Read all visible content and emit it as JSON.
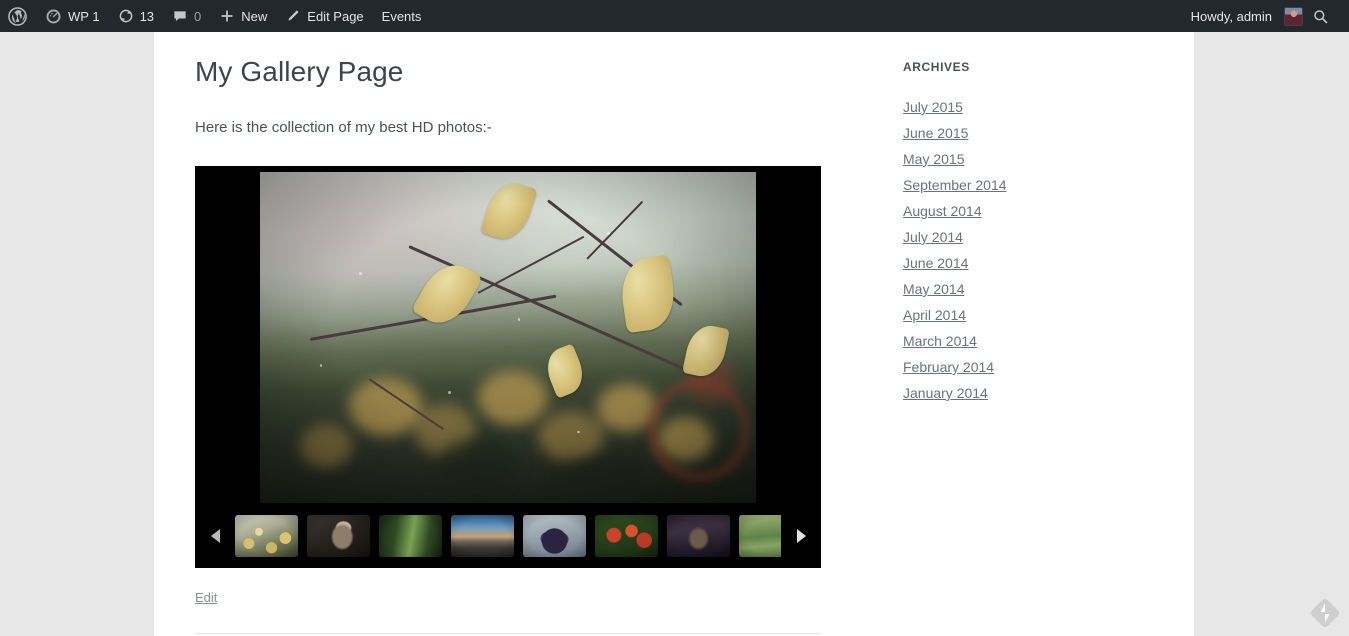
{
  "adminbar": {
    "wp_logo_icon": "wordpress-logo-icon",
    "site_icon": "dashboard-speedometer-icon",
    "site_label": "WP 1",
    "updates_icon": "updates-refresh-icon",
    "updates_count": "13",
    "comments_icon": "comment-bubble-icon",
    "comments_count": "0",
    "new_icon": "plus-icon",
    "new_label": "New",
    "edit_icon": "pencil-icon",
    "edit_label": "Edit Page",
    "events_label": "Events",
    "howdy": "Howdy, admin",
    "avatar_icon": "user-avatar",
    "search_icon": "search-icon",
    "bar_color": "#23282d",
    "text_color": "#b4b9be"
  },
  "content": {
    "title": "My Gallery Page",
    "intro": "Here is the collection of my best HD photos:-",
    "edit_label": "Edit"
  },
  "gallery": {
    "prev_icon": "chevron-left-icon",
    "next_icon": "chevron-right-icon",
    "hero_alt": "Autumn branch with yellow birch leaves and golden bokeh",
    "thumbnails": [
      {
        "alt": "Autumn leaves bokeh",
        "art": "t-leaves",
        "selected": true
      },
      {
        "alt": "Wolf in dark forest",
        "art": "t-wolf",
        "selected": false
      },
      {
        "alt": "Green forest trees",
        "art": "t-forest",
        "selected": false
      },
      {
        "alt": "Road at sunset",
        "art": "t-road",
        "selected": false
      },
      {
        "alt": "Hands holding blueberries",
        "art": "t-berries",
        "selected": false
      },
      {
        "alt": "Red tulips",
        "art": "t-tulips",
        "selected": false
      },
      {
        "alt": "Dark forest tunnel",
        "art": "t-dark",
        "selected": false
      },
      {
        "alt": "Misty green hills with fence",
        "art": "t-hills",
        "selected": false
      }
    ]
  },
  "sidebar": {
    "widget_title": "ARCHIVES",
    "archives": [
      "July 2015",
      "June 2015",
      "May 2015",
      "September 2014",
      "August 2014",
      "July 2014",
      "June 2014",
      "May 2014",
      "April 2014",
      "March 2014",
      "February 2014",
      "January 2014"
    ]
  },
  "corner": {
    "badge_icon": "jetpack-badge-icon"
  }
}
